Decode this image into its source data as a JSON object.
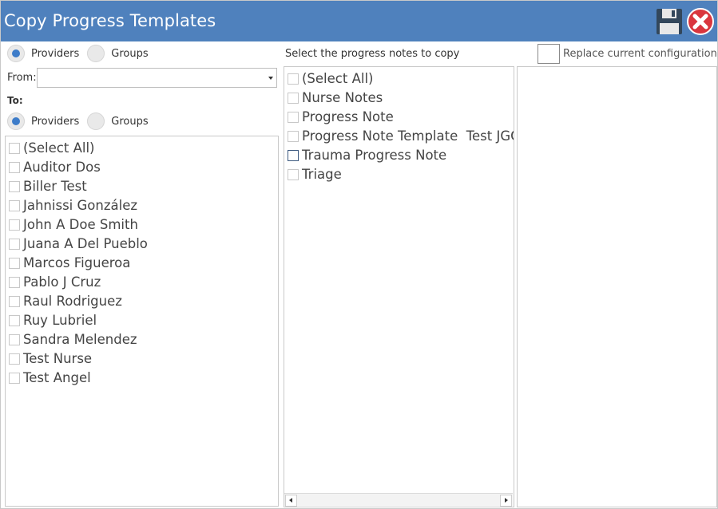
{
  "window": {
    "title": "Copy Progress Templates"
  },
  "from_type": {
    "providers": "Providers",
    "groups": "Groups",
    "selected": "Providers"
  },
  "from": {
    "label": "From:",
    "value": ""
  },
  "to": {
    "label": "To:",
    "providers": "Providers",
    "groups": "Groups",
    "selected": "Providers"
  },
  "recipients": [
    "(Select All)",
    "Auditor Dos",
    "Biller Test",
    "Jahnissi González",
    "John A Doe Smith",
    "Juana A Del Pueblo",
    "Marcos Figueroa",
    "Pablo J Cruz",
    "Raul Rodriguez",
    "Ruy Lubriel",
    "Sandra Melendez",
    "Test Nurse",
    "Test Angel"
  ],
  "notes_header": "Select the progress notes to copy",
  "notes": [
    "(Select All)",
    "Nurse Notes",
    "Progress Note",
    "Progress Note Template  Test JGG",
    "Trauma Progress Note",
    "Triage"
  ],
  "replace_label": "Replace current configuration",
  "icons": {
    "save": "save-icon",
    "close": "close-icon"
  },
  "colors": {
    "titlebar": "#4f81bd",
    "radio_selected": "#3d7cc9",
    "close_red": "#d9363e"
  }
}
